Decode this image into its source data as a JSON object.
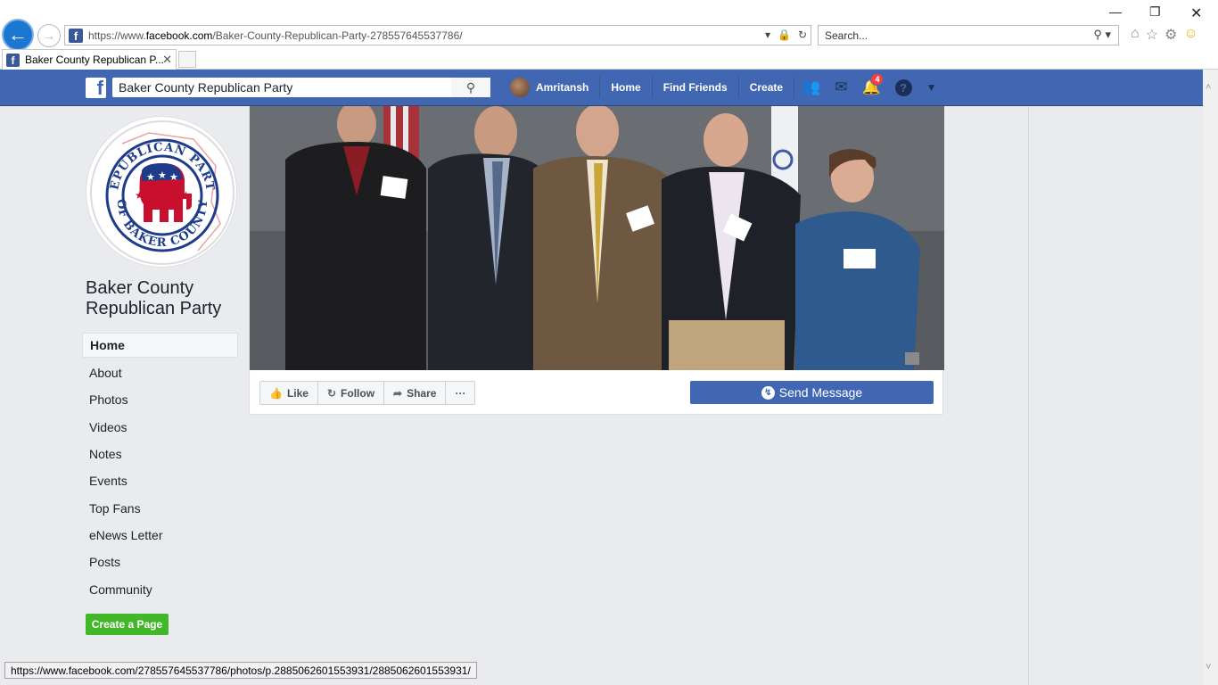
{
  "browser": {
    "url_prefix": "https://www.",
    "url_domain": "facebook.com",
    "url_path": "/Baker-County-Republican-Party-278557645537786/",
    "search_placeholder": "Search...",
    "tab_title": "Baker County Republican P...",
    "status_url": "https://www.facebook.com/278557645537786/photos/p.2885062601553931/2885062601553931/"
  },
  "fb_header": {
    "search_value": "Baker County Republican Party",
    "user_name": "Amritansh",
    "nav": [
      "Home",
      "Find Friends",
      "Create"
    ],
    "notification_count": "4"
  },
  "page": {
    "title": "Baker County Republican Party",
    "logo_text_top": "REPUBLICAN PARTY",
    "logo_text_bottom": "OF BAKER COUNTY",
    "nav_items": [
      "Home",
      "About",
      "Photos",
      "Videos",
      "Notes",
      "Events",
      "Top Fans",
      "eNews Letter",
      "Posts",
      "Community"
    ],
    "create_page_label": "Create a Page",
    "actions": {
      "like": "Like",
      "follow": "Follow",
      "share": "Share",
      "more": "···"
    },
    "send_message_label": "Send Message"
  },
  "colors": {
    "fb_blue": "#4267b2",
    "page_bg": "#e9ebee",
    "create_green": "#42b72a"
  }
}
